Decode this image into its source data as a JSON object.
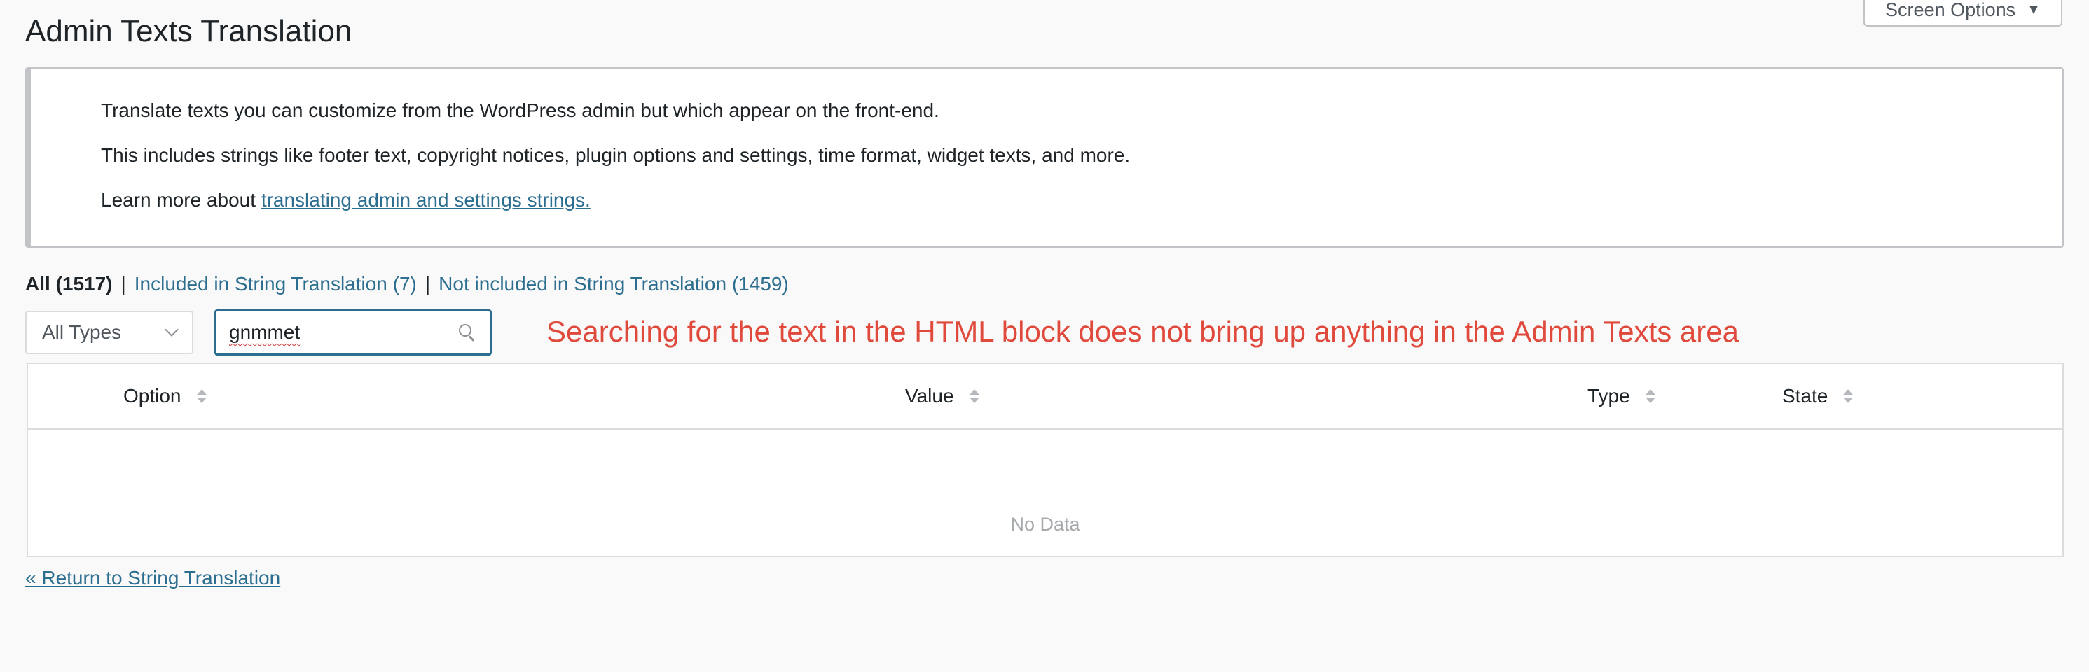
{
  "page": {
    "title": "Admin Texts Translation",
    "screen_options_label": "Screen Options"
  },
  "notice": {
    "line1": "Translate texts you can customize from the WordPress admin but which appear on the front-end.",
    "line2": "This includes strings like footer text, copyright notices, plugin options and settings, time format, widget texts, and more.",
    "line3_prefix": "Learn more about ",
    "line3_link": "translating admin and settings strings."
  },
  "filters": {
    "all": "All (1517)",
    "separator": "|",
    "included": "Included in String Translation (7)",
    "not_included": "Not included in String Translation (1459)"
  },
  "type_select": {
    "selected": "All Types"
  },
  "search": {
    "value": "gnmmet"
  },
  "annotation": "Searching for the text in the HTML block does not bring up anything in the Admin Texts area",
  "table": {
    "columns": [
      "Option",
      "Value",
      "Type",
      "State"
    ],
    "empty_text": "No Data"
  },
  "return_link": "« Return to String Translation",
  "colors": {
    "link": "#2c6e8f",
    "annotation": "#e04a3c",
    "focus_border": "#2c6e8f"
  },
  "icons": {
    "search": "search-icon",
    "screen_options_caret": "caret-down-icon",
    "select_chevron": "chevron-down-icon",
    "sort": "sort-arrows-icon"
  }
}
